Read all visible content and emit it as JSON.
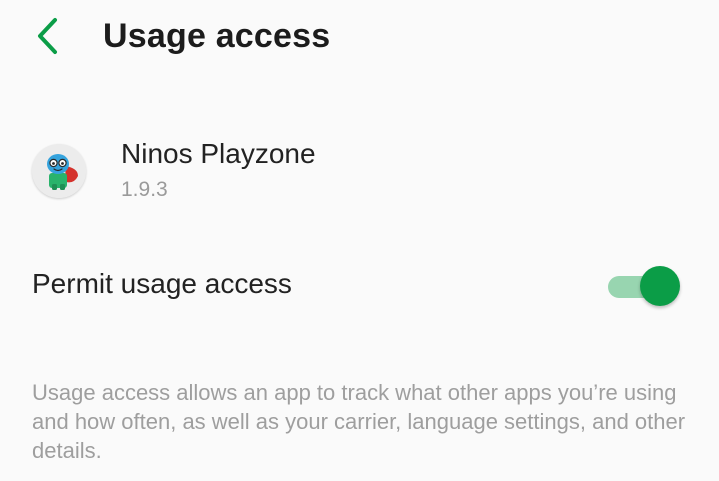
{
  "header": {
    "back_icon": "chevron-left-icon",
    "title": "Usage access"
  },
  "app": {
    "icon": "ninos-playzone-app-icon",
    "name": "Ninos Playzone",
    "version": "1.9.3"
  },
  "permit": {
    "label": "Permit usage access",
    "enabled": true
  },
  "description": "Usage access allows an app to track what other apps you’re using and how often, as well as your carrier, language settings, and other details.",
  "colors": {
    "accent": "#0b9d47",
    "accent_track": "#98d5b0",
    "background": "#fafafa",
    "secondary_text": "#9e9e9e"
  }
}
